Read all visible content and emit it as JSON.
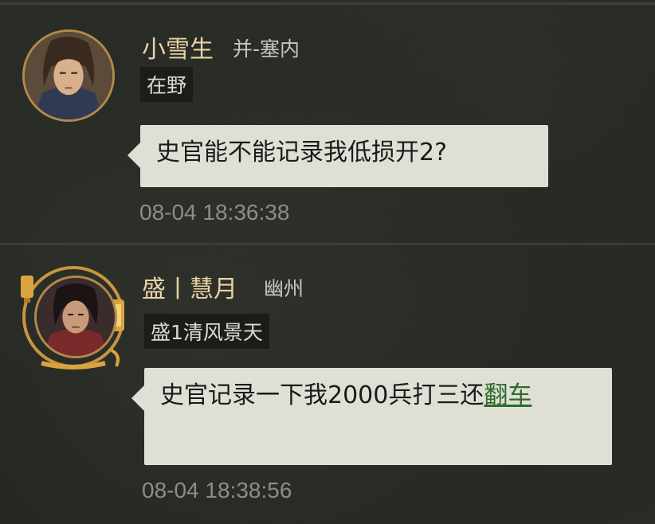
{
  "messages": [
    {
      "name": "小雪生",
      "location": "并-塞内",
      "tag": "在野",
      "text": "史官能不能记录我低损开2?",
      "time": "08-04 18:36:38",
      "avatar_icon": "warrior-portrait-icon"
    },
    {
      "name": "盛丨慧月",
      "location": "幽州",
      "tag": "盛1清风景天",
      "text_main": "史官记录一下我2000兵打三还",
      "text_link": "翻车",
      "time": "08-04 18:38:56",
      "avatar_icon": "warrior-portrait-icon",
      "frame_icon": "lantern-frame-icon"
    }
  ],
  "colors": {
    "name": "#e9d3a6",
    "bubble": "#dfdfd6",
    "link": "#2e6b2c",
    "time": "#8e8d85",
    "background": "#262824"
  }
}
